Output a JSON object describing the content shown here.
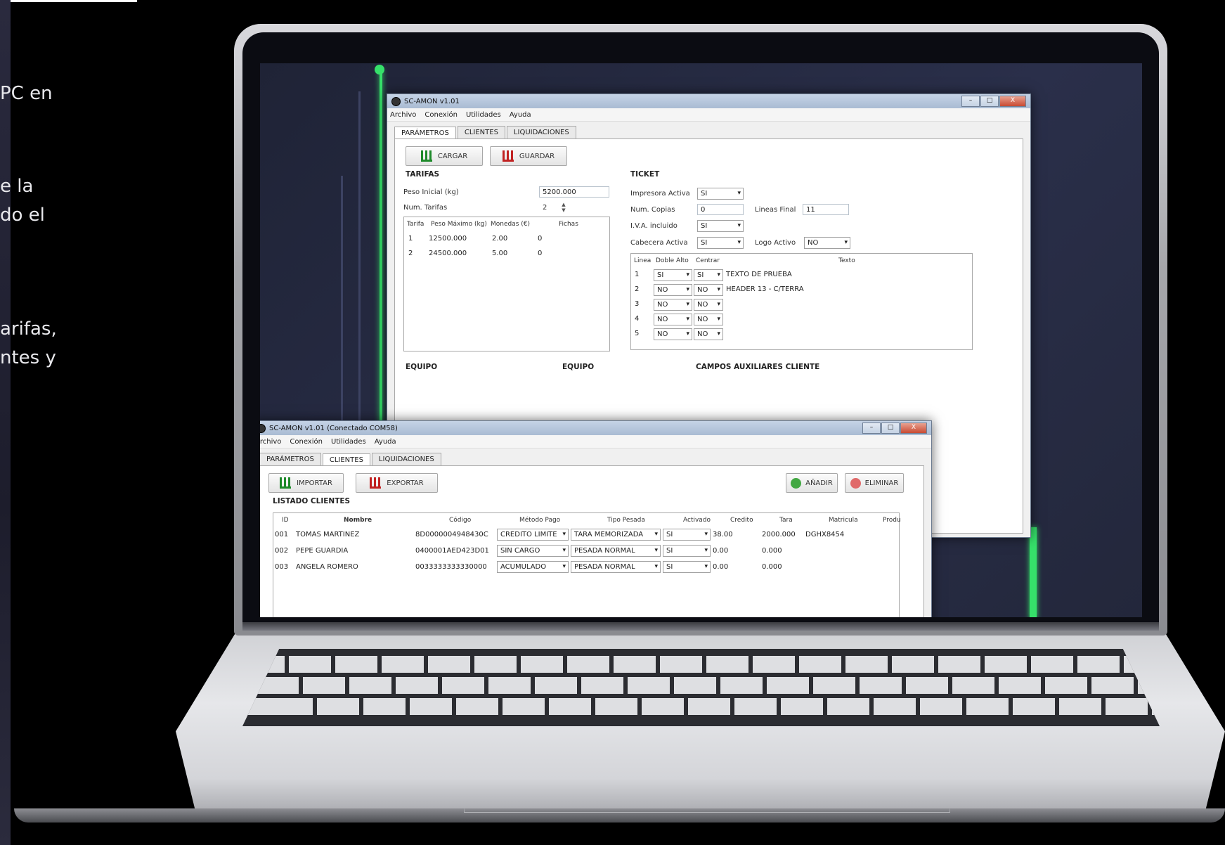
{
  "side_text": [
    "PC en",
    "e la",
    "do el",
    "arifas,",
    "ntes y"
  ],
  "colors": {
    "accent_trace": "#36e06a",
    "close_button": "#c84a32"
  },
  "window_back": {
    "title": "SC-AMON v1.01",
    "buttons": [
      "–",
      "□",
      "X"
    ],
    "menu": [
      "Archivo",
      "Conexión",
      "Utilidades",
      "Ayuda"
    ],
    "tabs": [
      "PARÁMETROS",
      "CLIENTES",
      "LIQUIDACIONES"
    ],
    "active_tab": "PARÁMETROS",
    "load_button": "CARGAR",
    "save_button": "GUARDAR",
    "tarifas": {
      "title": "TARIFAS",
      "peso_inicial_label": "Peso Inicial (kg)",
      "peso_inicial_value": "5200.000",
      "num_tarifas_label": "Num. Tarifas",
      "num_tarifas_value": "2",
      "columns": [
        "Tarifa",
        "Peso Máximo (kg)",
        "Monedas (€)",
        "Fichas"
      ],
      "rows": [
        [
          "1",
          "12500.000",
          "2.00",
          "0"
        ],
        [
          "2",
          "24500.000",
          "5.00",
          "0"
        ]
      ]
    },
    "ticket": {
      "title": "TICKET",
      "impresora_label": "Impresora Activa",
      "impresora_value": "SI",
      "copias_label": "Num. Copias",
      "copias_value": "0",
      "lineas_final_label": "Lineas Final",
      "lineas_final_value": "11",
      "iva_label": "I.V.A. incluido",
      "iva_value": "SI",
      "cabecera_label": "Cabecera Activa",
      "cabecera_value": "SI",
      "logo_label": "Logo Activo",
      "logo_value": "NO",
      "columns": [
        "Linea",
        "Doble Alto",
        "Centrar",
        "Texto"
      ],
      "rows": [
        [
          "1",
          "SI",
          "SI",
          "TEXTO DE PRUEBA"
        ],
        [
          "2",
          "NO",
          "NO",
          "HEADER 13 - C/TERRA"
        ],
        [
          "3",
          "NO",
          "NO",
          ""
        ],
        [
          "4",
          "NO",
          "NO",
          ""
        ],
        [
          "5",
          "NO",
          "NO",
          ""
        ]
      ]
    },
    "equipo_1": "EQUIPO",
    "equipo_2": "EQUIPO",
    "campos_aux": "CAMPOS AUXILIARES CLIENTE"
  },
  "window_front": {
    "title": "SC-AMON v1.01 (Conectado COM58)",
    "buttons": [
      "–",
      "□",
      "X"
    ],
    "menu": [
      "Archivo",
      "Conexión",
      "Utilidades",
      "Ayuda"
    ],
    "tabs": [
      "PARÁMETROS",
      "CLIENTES",
      "LIQUIDACIONES"
    ],
    "active_tab": "CLIENTES",
    "import_button": "IMPORTAR",
    "export_button": "EXPORTAR",
    "add_button": "AÑADIR",
    "delete_button": "ELIMINAR",
    "list_title": "LISTADO CLIENTES",
    "columns": [
      "ID",
      "Nombre",
      "Código",
      "Método Pago",
      "Tipo Pesada",
      "Activado",
      "Credito",
      "Tara",
      "Matricula",
      "Produ"
    ],
    "rows": [
      [
        "001",
        "TOMAS MARTINEZ",
        "8D0000004948430C",
        "CREDITO LIMITE",
        "TARA MEMORIZADA",
        "SI",
        "38.00",
        "2000.000",
        "DGHX8454"
      ],
      [
        "002",
        "PEPE GUARDIA",
        "0400001AED423D01",
        "SIN CARGO",
        "PESADA NORMAL",
        "SI",
        "0.00",
        "0.000",
        ""
      ],
      [
        "003",
        "ANGELA ROMERO",
        "0033333333330000",
        "ACUMULADO",
        "PESADA NORMAL",
        "SI",
        "0.00",
        "0.000",
        ""
      ]
    ]
  }
}
